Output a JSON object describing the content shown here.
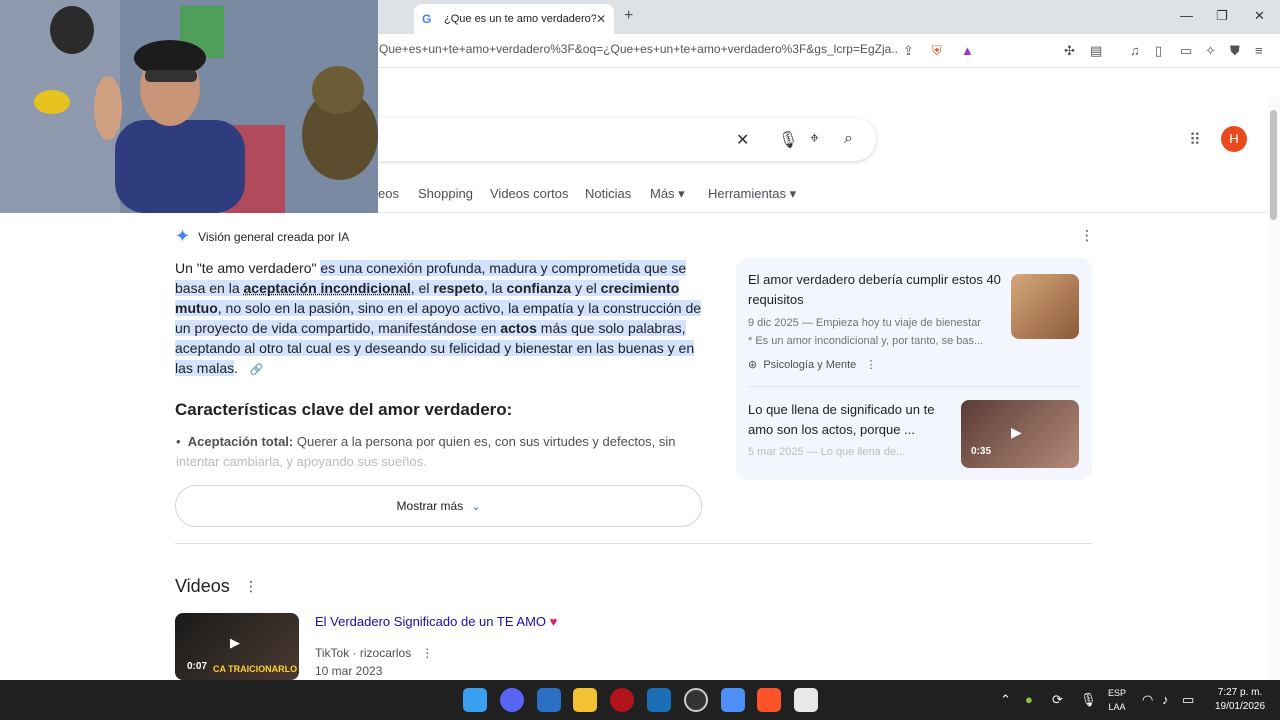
{
  "browser": {
    "tab_title": "¿Que es un te amo verdadero?",
    "tab_close": "✕",
    "new_tab": "+",
    "url": "Que+es+un+te+amo+verdadero%3F&oq=¿Que+es+un+te+amo+verdadero%3F&gs_lcrp=EgZja..."
  },
  "nav": {
    "tabs": [
      "eos",
      "Shopping",
      "Videos cortos",
      "Noticias",
      "Más",
      "Herramientas"
    ]
  },
  "account": {
    "initial": "H"
  },
  "ai_overview": {
    "label": "Visión general creada por IA",
    "p_intro": "Un \"te amo verdadero\" ",
    "p_1": "es una conexión profunda, madura y comprometida que se basa en la ",
    "p_b1": "aceptación incondicional",
    "p_2": ", el ",
    "p_b2": "respeto",
    "p_3": ", la ",
    "p_b3": "confianza",
    "p_4": " y el ",
    "p_b4": "crecimiento mutuo",
    "p_5": ", no solo en la pasión, sino en el apoyo activo, la empatía y la construcción de un proyecto de vida compartido, manifestándose en ",
    "p_b5": "actos",
    "p_6": " más que solo palabras, aceptando al otro tal cual es y deseando su felicidad y bienestar en las buenas y en las malas",
    "p_end": ".",
    "heading": "Características clave del amor verdadero:",
    "bullet_title": "Aceptación total:",
    "bullet_text": " Querer a la persona por quien es, con sus virtudes y defectos, sin ",
    "bullet_fade": "intentar cambiarla, y apoyando sus sueños.",
    "show_more": "Mostrar más"
  },
  "cards": [
    {
      "title": "El amor verdadero debería cumplir estos 40 requisitos",
      "meta1": "9 dic 2025 — Empieza hoy tu viaje de bienestar",
      "meta2": "* Es un amor incondicional y, por tanto, se bas...",
      "source": "Psicología y Mente"
    },
    {
      "title": "Lo que llena de significado un te amo son los actos, porque ...",
      "meta1": "5 mar 2025 — Lo que llena de...",
      "duration": "0:35"
    }
  ],
  "videos": {
    "heading": "Videos",
    "item": {
      "title": "El Verdadero Significado de un TE AMO",
      "source": "TikTok · rizocarlos",
      "date": "10 mar 2023",
      "duration": "0:07",
      "thumb_caption": "CA TRAICIONARLO"
    }
  },
  "taskbar": {
    "lang1": "ESP",
    "lang2": "LAA",
    "time": "7:27 p. m.",
    "date": "19/01/2026"
  }
}
